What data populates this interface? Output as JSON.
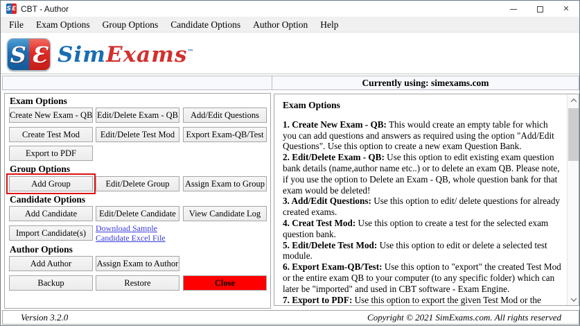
{
  "window": {
    "title": "CBT - Author",
    "controls": {
      "close_glyph": "✕"
    }
  },
  "menu": {
    "items": [
      "File",
      "Exam Options",
      "Group Options",
      "Candidate Options",
      "Author Option",
      "Help"
    ]
  },
  "logo": {
    "badge_left": "S",
    "badge_right": "Ɛ",
    "brand_first": "Sim",
    "brand_second": "Exams",
    "trademark": "™"
  },
  "status": {
    "currently_using": "Currently using: simexams.com"
  },
  "left_panel": {
    "exam": {
      "heading": "Exam Options",
      "buttons": [
        "Create New Exam - QB",
        "Edit/Delete Exam - QB",
        "Add/Edit Questions",
        "Create Test Mod",
        "Edit/Delete Test Mod",
        "Export Exam-QB/Test",
        "Export to PDF"
      ]
    },
    "group": {
      "heading": "Group Options",
      "buttons": [
        "Add Group",
        "Edit/Delete Group",
        "Assign Exam to Group"
      ]
    },
    "candidate": {
      "heading": "Candidate Options",
      "buttons": [
        "Add Candidate",
        "Edit/Delete Candidate",
        "View Candidate Log",
        "Import Candidate(s)"
      ],
      "download_link": {
        "line1": "Download Sample",
        "line2": "Candidate Excel File"
      }
    },
    "author": {
      "heading": "Author Options",
      "buttons": [
        "Add Author",
        "Assign Exam to Author",
        "Backup",
        "Restore",
        "Close"
      ]
    }
  },
  "right_panel": {
    "heading": "Exam Options",
    "items": [
      {
        "label": "1. Create New Exam - QB:",
        "text": " This would create an empty table for which you can add questions and answers as required using the option \"Add/Edit Questions\". Use this option to create a new exam Question Bank."
      },
      {
        "label": "2. Edit/Delete Exam - QB:",
        "text": " Use this option to edit existing exam question bank details (name,author name etc..) or to delete an exam QB. Please note, if you use the option to Delete an Exam - QB, whole question bank for that exam would be deleted!"
      },
      {
        "label": "3. Add/Edit Questions:",
        "text": " Use this option to edit/ delete questions for already created exams."
      },
      {
        "label": "4. Creat Test Mod:",
        "text": " Use this option to create a test for the selected exam question bank."
      },
      {
        "label": "5. Edit/Delete Test Mod:",
        "text": " Use this option to edit or delete a selected test module."
      },
      {
        "label": "6. Export Exam-QB/Test:",
        "text": " Use this option to \"export\" the created Test Mod or the entire exam QB to your computer (to any specific folder) which can later be \"imported\" and used in CBT software - Exam Engine."
      },
      {
        "label": "7. Export to PDF:",
        "text": " Use this option to export the given Test Mod or the entire"
      }
    ]
  },
  "footer": {
    "version": "Version 3.2.0",
    "copyright": "Copyright © 2021 SimExams.com. All rights reserved"
  },
  "colors": {
    "logo_blue": "#1a6db3",
    "logo_red": "#dd2525",
    "close_button_red": "#fe0000",
    "highlight_red": "#e01010",
    "link_blue": "#3838dd"
  }
}
